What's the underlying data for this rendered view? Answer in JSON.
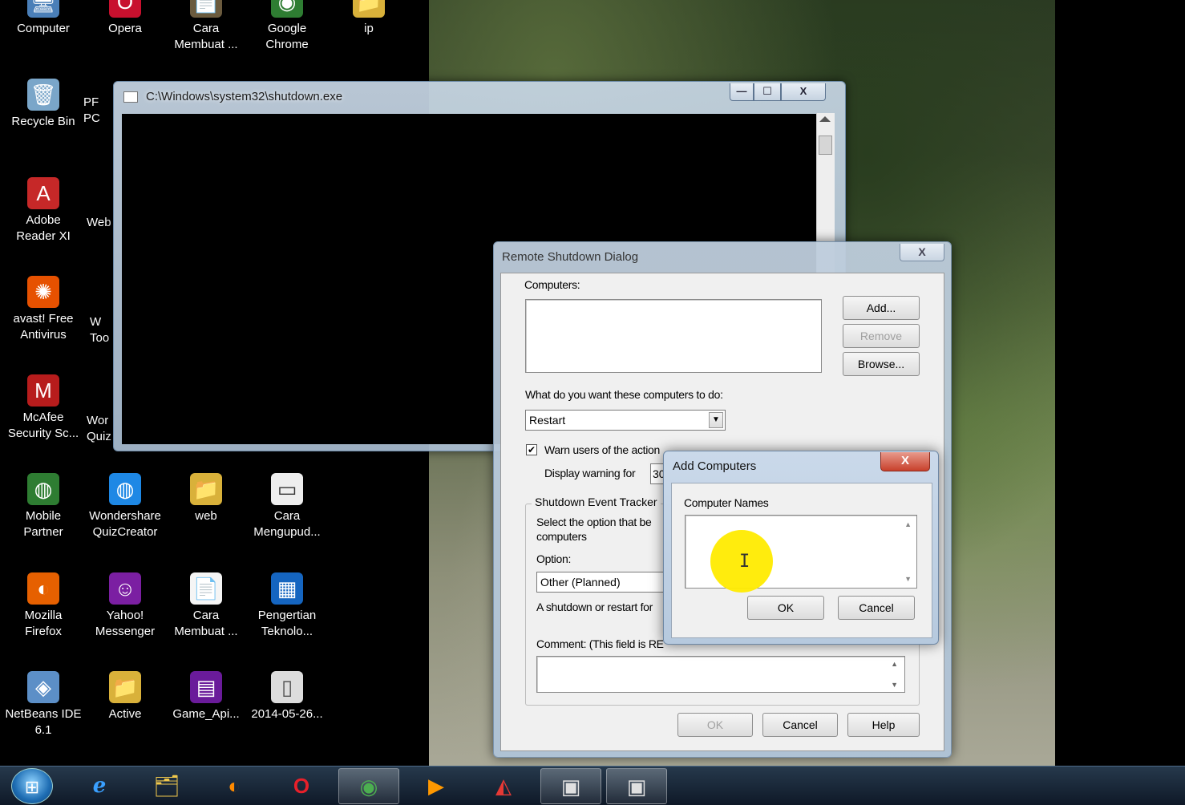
{
  "desktop": {
    "icons": [
      {
        "label": "Computer",
        "icon": "computer-icon",
        "glyph": "🖥"
      },
      {
        "label": "Opera",
        "icon": "opera-icon",
        "glyph": "O"
      },
      {
        "label": "Cara\nMembuat ...",
        "icon": "shortcut-icon",
        "glyph": "📄"
      },
      {
        "label": "Google\nChrome",
        "icon": "chrome-icon",
        "glyph": "◉"
      },
      {
        "label": "ip",
        "icon": "folder-icon",
        "glyph": "📁"
      },
      {
        "label": "Recycle Bin",
        "icon": "recycle-bin-icon",
        "glyph": "🗑"
      },
      {
        "label": "PF\nPC",
        "icon": "shortcut-icon",
        "glyph": "▣"
      },
      {
        "label": "Adobe\nReader XI",
        "icon": "adobe-reader-icon",
        "glyph": "A"
      },
      {
        "label": "Web",
        "icon": "shortcut-icon",
        "glyph": "▣"
      },
      {
        "label": "avast! Free\nAntivirus",
        "icon": "avast-icon",
        "glyph": "✺"
      },
      {
        "label": "W\nToo",
        "icon": "shortcut-icon",
        "glyph": "▣"
      },
      {
        "label": "McAfee\nSecurity Sc...",
        "icon": "mcafee-icon",
        "glyph": "M"
      },
      {
        "label": "Wor\nQuiz",
        "icon": "shortcut-icon",
        "glyph": "▣"
      },
      {
        "label": "Mobile\nPartner",
        "icon": "mobile-partner-icon",
        "glyph": "◍"
      },
      {
        "label": "Wondershare\nQuizCreator",
        "icon": "quizcreator-icon",
        "glyph": "◍"
      },
      {
        "label": "web",
        "icon": "folder-icon",
        "glyph": "📁"
      },
      {
        "label": "Cara\nMengupud...",
        "icon": "document-icon",
        "glyph": "▭"
      },
      {
        "label": "Mozilla\nFirefox",
        "icon": "firefox-icon",
        "glyph": "◐"
      },
      {
        "label": "Yahoo!\nMessenger",
        "icon": "yahoo-messenger-icon",
        "glyph": "☺"
      },
      {
        "label": "Cara\nMembuat ...",
        "icon": "firefox-document-icon",
        "glyph": "📄"
      },
      {
        "label": "Pengertian\nTeknolo...",
        "icon": "image-icon",
        "glyph": "▦"
      },
      {
        "label": "NetBeans IDE\n6.1",
        "icon": "netbeans-icon",
        "glyph": "◈"
      },
      {
        "label": "Active",
        "icon": "folder-icon",
        "glyph": "📁"
      },
      {
        "label": "Game_Api...",
        "icon": "winrar-icon",
        "glyph": "▤"
      },
      {
        "label": "2014-05-26...",
        "icon": "file-icon",
        "glyph": "▯"
      }
    ]
  },
  "console_window": {
    "title": "C:\\Windows\\system32\\shutdown.exe",
    "minimize": "—",
    "maximize": "☐",
    "close": "X"
  },
  "remote_shutdown": {
    "title": "Remote Shutdown Dialog",
    "close": "X",
    "computers_label": "Computers:",
    "add_button": "Add...",
    "remove_button": "Remove",
    "browse_button": "Browse...",
    "action_question": "What do you want these computers to do:",
    "action_value": "Restart",
    "warn_users_label": "Warn users of the action",
    "warn_checked": "✔",
    "display_warning_label": "Display warning for",
    "display_warning_value": "30",
    "tracker_legend": "Shutdown Event Tracker",
    "tracker_desc": "Select the option that be\ncomputers",
    "option_label": "Option:",
    "option_value": "Other (Planned)",
    "planned_text": "A shutdown or restart for",
    "comment_label": "Comment: (This field is RE",
    "ok_button": "OK",
    "cancel_button": "Cancel",
    "help_button": "Help"
  },
  "add_computers": {
    "title": "Add Computers",
    "close": "X",
    "names_label": "Computer Names",
    "names_value": "",
    "ok_button": "OK",
    "cancel_button": "Cancel"
  },
  "taskbar": {
    "start": "⊞",
    "items": [
      {
        "name": "internet-explorer-icon",
        "glyph": "e"
      },
      {
        "name": "file-explorer-icon",
        "glyph": "🗂"
      },
      {
        "name": "firefox-icon",
        "glyph": "◐"
      },
      {
        "name": "opera-icon",
        "glyph": "O"
      },
      {
        "name": "chrome-icon",
        "glyph": "◉"
      },
      {
        "name": "media-player-icon",
        "glyph": "▶"
      },
      {
        "name": "app-icon",
        "glyph": "◭"
      },
      {
        "name": "console-window-icon",
        "glyph": "▣"
      },
      {
        "name": "dialog-window-icon",
        "glyph": "▣"
      }
    ]
  }
}
